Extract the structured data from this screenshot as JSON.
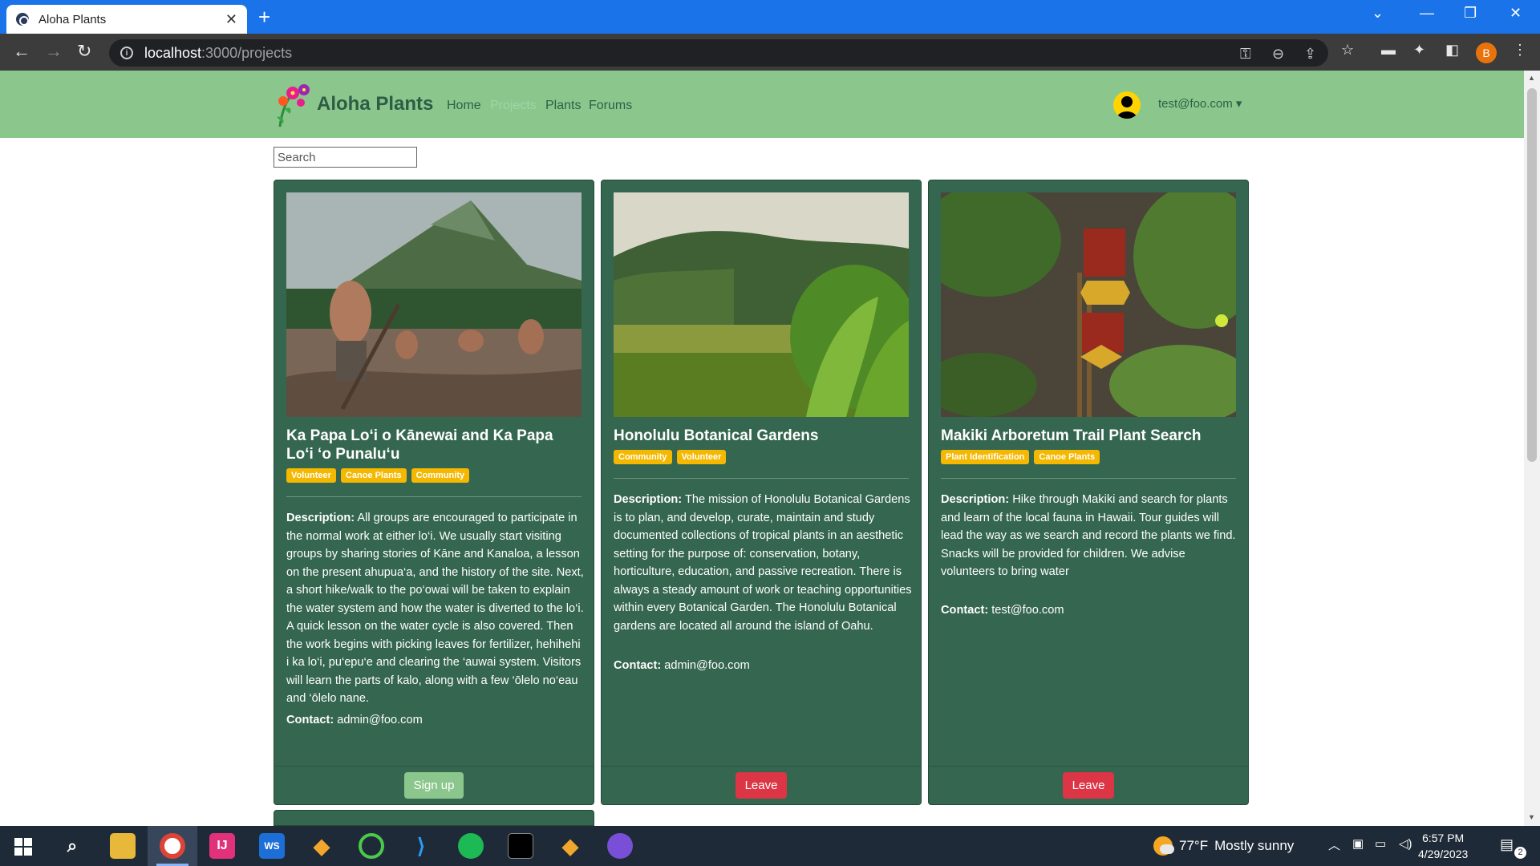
{
  "browser": {
    "tab_title": "Aloha Plants",
    "tab_close": "✕",
    "new_tab": "+",
    "url_host": "localhost",
    "url_path": ":3000/projects",
    "profile_initial": "B"
  },
  "navbar": {
    "brand": "Aloha Plants",
    "links": [
      "Home",
      "Projects",
      "Plants",
      "Forums"
    ],
    "active_link": "Projects",
    "user_email": "test@foo.com ▾"
  },
  "search": {
    "placeholder": "Search"
  },
  "cards": [
    {
      "title": "Ka Papa Lo‘i o Kānewai and Ka Papa Lo‘i ‘o Punalu‘u",
      "tags": [
        "Volunteer",
        "Canoe Plants",
        "Community"
      ],
      "description_label": "Description:",
      "description": "All groups are encouraged to participate in the normal work at either lo‘i. We usually start visiting groups by sharing stories of Kāne and Kanaloa, a lesson on the present ahupua‘a, and the history of the site. Next, a short hike/walk to the po‘owai will be taken to explain the water system and how the water is diverted to the lo‘i. A quick lesson on the water cycle is also covered. Then the work begins with picking leaves for fertilizer, hehihehi i ka lo‘i, pu‘epu‘e and clearing the ‘auwai system. Visitors will learn the parts of kalo, along with a few ‘ōlelo no‘eau and ‘ōlelo nane.",
      "contact_label": "Contact:",
      "contact": "admin@foo.com",
      "button": "Sign up"
    },
    {
      "title": "Honolulu Botanical Gardens",
      "tags": [
        "Community",
        "Volunteer"
      ],
      "description_label": "Description:",
      "description": "The mission of Honolulu Botanical Gardens is to plan, and develop, curate, maintain and study documented collections of tropical plants in an aesthetic setting for the purpose of: conservation, botany, horticulture, education, and passive recreation. There is always a steady amount of work or teaching opportunities within every Botanical Garden. The Honolulu Botanical gardens are located all around the island of Oahu.",
      "contact_label": "Contact:",
      "contact": "admin@foo.com",
      "button": "Leave"
    },
    {
      "title": "Makiki Arboretum Trail Plant Search",
      "tags": [
        "Plant Identification",
        "Canoe Plants"
      ],
      "description_label": "Description:",
      "description": "Hike through Makiki and search for plants and learn of the local fauna in Hawaii. Tour guides will lead the way as we search and record the plants we find. Snacks will be provided for children. We advise volunteers to bring water",
      "contact_label": "Contact:",
      "contact": "test@foo.com",
      "button": "Leave"
    }
  ],
  "taskbar": {
    "weather_temp": "77°F",
    "weather_text": "Mostly sunny",
    "time": "6:57 PM",
    "date": "4/29/2023",
    "notifications": "2"
  },
  "colors": {
    "navbar": "#8bc78c",
    "card": "#356650",
    "badge": "#f5b800",
    "leave": "#dc3545",
    "signup": "#8bc78c"
  }
}
